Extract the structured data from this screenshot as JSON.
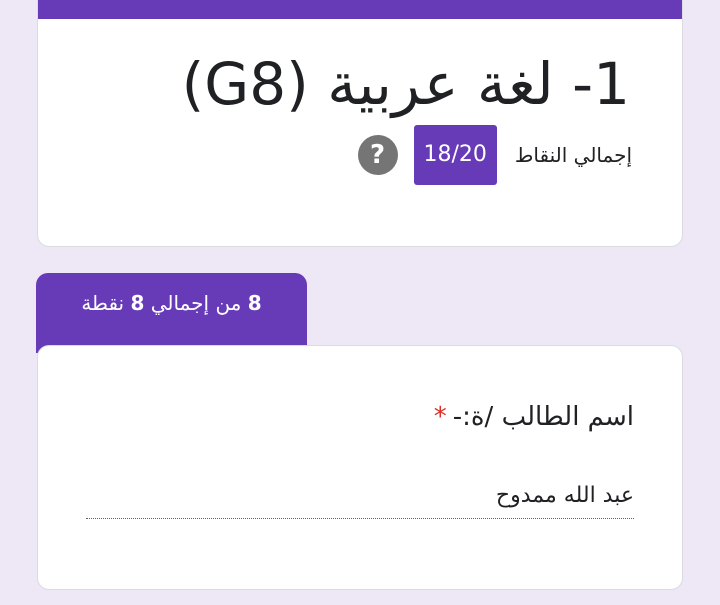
{
  "form": {
    "title": "1- لغة عربية (G8)",
    "score_label": "إجمالي النقاط",
    "score_value": "18/20",
    "help_icon_glyph": "?"
  },
  "section": {
    "points_earned": "8",
    "points_middle": " من إجمالي ",
    "points_total": "8",
    "points_suffix": " نقطة"
  },
  "question": {
    "label": "اسم الطالب /ة:-",
    "required_mark": "*",
    "answer_value": "عبد الله ممدوح"
  },
  "colors": {
    "accent": "#673ab7",
    "background": "#ede7f6",
    "required": "#d93025"
  }
}
